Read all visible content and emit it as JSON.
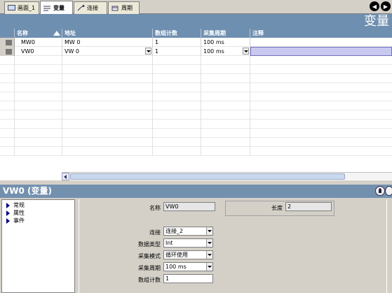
{
  "tabs": [
    {
      "label": "画面_1",
      "icon": "screen-icon"
    },
    {
      "label": "变量",
      "icon": "variable-icon"
    },
    {
      "label": "连接",
      "icon": "connection-icon"
    },
    {
      "label": "周期",
      "icon": "cycle-icon"
    }
  ],
  "editor_title": "变量",
  "columns": [
    "名称",
    "地址",
    "数组计数",
    "采集周期",
    "注释"
  ],
  "rows": [
    {
      "name": "MW0",
      "address": "MW 0",
      "count": "1",
      "cycle": "100 ms",
      "comment": ""
    },
    {
      "name": "VW0",
      "address": "VW 0",
      "count": "1",
      "cycle": "100 ms",
      "comment": ""
    }
  ],
  "properties": {
    "title": "VW0 (变量)",
    "tree": [
      "常规",
      "属性",
      "事件"
    ],
    "fields": {
      "name_label": "名称",
      "name_value": "VW0",
      "length_label": "长度",
      "length_value": "2",
      "connection_label": "连接",
      "connection_value": "连接_2",
      "datatype_label": "数据类型",
      "datatype_value": "Int",
      "mode_label": "采集模式",
      "mode_value": "循环使用",
      "cycle_label": "采集周期",
      "cycle_value": "100 ms",
      "count_label": "数组计数",
      "count_value": "1"
    }
  },
  "colors": {
    "header": "#6f8fb0",
    "panel": "#d4d0c8",
    "selection": "#c9c9f0"
  }
}
